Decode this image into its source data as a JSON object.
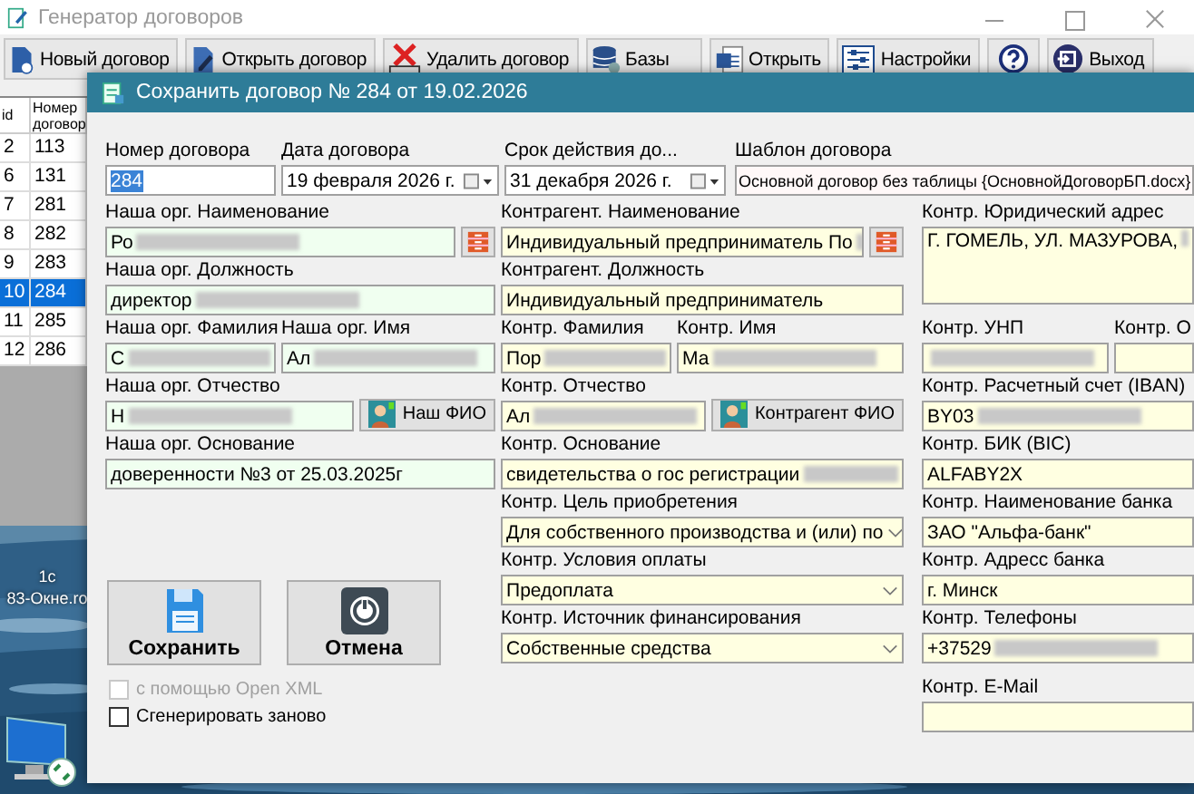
{
  "main_window": {
    "title": "Генератор договоров",
    "toolbar": [
      {
        "label": "Новый договор",
        "kind": "new"
      },
      {
        "label": "Открыть договор",
        "kind": "edit"
      },
      {
        "label": "Удалить  договор",
        "kind": "delete"
      },
      {
        "label": "Базы",
        "kind": "db"
      },
      {
        "label": "Открыть",
        "kind": "word"
      },
      {
        "label": "Настройки",
        "kind": "settings"
      },
      {
        "kind": "help"
      },
      {
        "label": "Выход",
        "kind": "exit"
      }
    ],
    "table": {
      "columns": [
        "id",
        "Номер договор"
      ],
      "rows": [
        {
          "cells": [
            "2",
            "113"
          ],
          "selected": false
        },
        {
          "cells": [
            "6",
            "131"
          ],
          "selected": false
        },
        {
          "cells": [
            "7",
            "281"
          ],
          "selected": false
        },
        {
          "cells": [
            "8",
            "282"
          ],
          "selected": false
        },
        {
          "cells": [
            "9",
            "283"
          ],
          "selected": false
        },
        {
          "cells": [
            "10",
            "284"
          ],
          "selected": true
        },
        {
          "cells": [
            "11",
            "285"
          ],
          "selected": false
        },
        {
          "cells": [
            "12",
            "286"
          ],
          "selected": false
        }
      ]
    }
  },
  "desktop_icons": [
    {
      "label": "1с",
      "kind": "text"
    },
    {
      "label": "83-Окне.ro",
      "kind": "text"
    },
    {
      "kind": "computer"
    }
  ],
  "dialog": {
    "title": "Сохранить договор № 284 от 19.02.2026",
    "top_row": [
      {
        "kind": "text",
        "label": "Номер договора",
        "value": "284",
        "highlighted": true
      },
      {
        "kind": "date",
        "label": "Дата договора",
        "value": "19 февраля 2026 г."
      },
      {
        "kind": "date",
        "label": "Срок действия до...",
        "value": "31 декабря  2026 г."
      },
      {
        "kind": "template",
        "label": "Шаблон договора",
        "value": "Основной договор без таблицы {ОсновнойДоговорБП.docx}"
      }
    ],
    "our_org": [
      [
        {
          "kind": "text",
          "label": "Наша орг. Наименование",
          "value": "Ро",
          "redacted": true
        },
        {
          "kind": "icon-button"
        }
      ],
      [
        {
          "kind": "text",
          "label": "Наша орг. Должность",
          "value": "директор",
          "redacted": true
        }
      ],
      [
        {
          "kind": "text",
          "label": "Наша орг. Фамилия",
          "value": "С",
          "redacted": true
        },
        {
          "kind": "text",
          "label": "Наша орг. Имя",
          "value": "Ал",
          "redacted": true
        }
      ],
      [
        {
          "kind": "text",
          "label": "Наша орг. Отчество",
          "value": "Н",
          "redacted": true
        },
        {
          "kind": "button",
          "label": "Наш ФИО"
        }
      ],
      [
        {
          "kind": "text",
          "label": "Наша орг. Основание",
          "value": "доверенности №3 от 25.03.2025г"
        }
      ]
    ],
    "counterparty": [
      [
        {
          "kind": "text",
          "label": "Контрагент. Наименование",
          "value": "Индивидуальный предприниматель По",
          "redacted": true
        },
        {
          "kind": "icon-button"
        }
      ],
      [
        {
          "kind": "text",
          "label": "Контрагент. Должность",
          "value": "Индивидуальный предприниматель"
        }
      ],
      [
        {
          "kind": "text",
          "label": "Контр. Фамилия",
          "value": "Пор",
          "redacted": true
        },
        {
          "kind": "text",
          "label": "Контр. Имя",
          "value": "Ма",
          "redacted": true
        }
      ],
      [
        {
          "kind": "text",
          "label": "Контр. Отчество",
          "value": "Ал",
          "redacted": true
        },
        {
          "kind": "button",
          "label": "Контрагент ФИО"
        }
      ],
      [
        {
          "kind": "text",
          "label": "Контр. Основание",
          "value": "свидетельства о гос регистрации",
          "redacted": true
        }
      ],
      [
        {
          "kind": "combo",
          "label": "Контр. Цель приобретения",
          "value": "Для собственного производства и (или) по"
        }
      ],
      [
        {
          "kind": "combo",
          "label": "Контр. Условия оплаты",
          "value": "Предоплата"
        }
      ],
      [
        {
          "kind": "combo",
          "label": "Контр. Источник финансирования",
          "value": "Собственные средства"
        }
      ]
    ],
    "counterparty_bank": [
      [
        {
          "kind": "textarea",
          "label": "Контр. Юридический адрес",
          "value": "Г. ГОМЕЛЬ, УЛ. МАЗУРОВА,",
          "redacted": true
        }
      ],
      [
        {
          "kind": "text",
          "label": "Контр. УНП",
          "redacted": true
        },
        {
          "kind": "text",
          "label": "Контр. О"
        }
      ],
      [
        {
          "kind": "text",
          "label": "Контр. Расчетный счет (IBAN)",
          "value": "BY03",
          "redacted": true
        }
      ],
      [
        {
          "kind": "text",
          "label": "Контр. БИК (BIC)",
          "value": "ALFABY2X"
        }
      ],
      [
        {
          "kind": "text",
          "label": "Контр.  Наименование банка",
          "value": "ЗАО \"Альфа-банк\""
        }
      ],
      [
        {
          "kind": "text",
          "label": "Контр.  Адресс банка",
          "value": "г. Минск"
        }
      ],
      [
        {
          "kind": "text",
          "label": "Контр.  Телефоны",
          "value": "+37529",
          "redacted": true
        }
      ],
      [
        {
          "kind": "text",
          "label": "Контр.  E-Mail"
        }
      ]
    ],
    "actions": [
      {
        "label": "Сохранить",
        "kind": "save"
      },
      {
        "label": "Отмена",
        "kind": "cancel"
      }
    ],
    "checkboxes": [
      {
        "label": "с помощью Open XML",
        "checked": false,
        "disabled": true
      },
      {
        "label": "Сгенерировать заново",
        "checked": false,
        "disabled": false
      }
    ]
  }
}
